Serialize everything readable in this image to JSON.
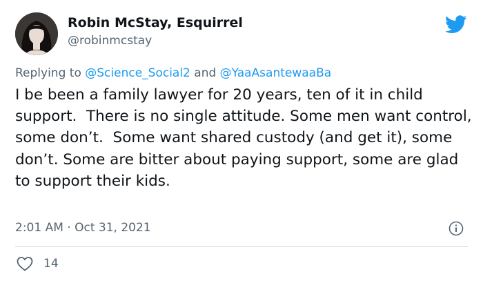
{
  "author": {
    "display_name": "Robin McStay, Esquirrel",
    "handle": "@robinmcstay"
  },
  "reply_context": {
    "prefix": "Replying to ",
    "mention1": "@Science_Social2",
    "connector": " and ",
    "mention2": "@YaaAsantewaaBa"
  },
  "tweet": {
    "text": "I be been a family lawyer for 20 years, ten of it in child support.  There is no single attitude. Some men want control, some don’t.  Some want shared custody (and get it), some don’t. Some are bitter about paying support, some are glad to support their kids.",
    "timestamp": "2:01 AM · Oct 31, 2021"
  },
  "stats": {
    "likes": "14"
  },
  "icons": {
    "brand": "twitter-bird-icon",
    "info": "info-icon",
    "like": "heart-icon"
  },
  "colors": {
    "brand": "#1d9bf0",
    "secondary_text": "#536471",
    "divider": "#cfd9de"
  }
}
